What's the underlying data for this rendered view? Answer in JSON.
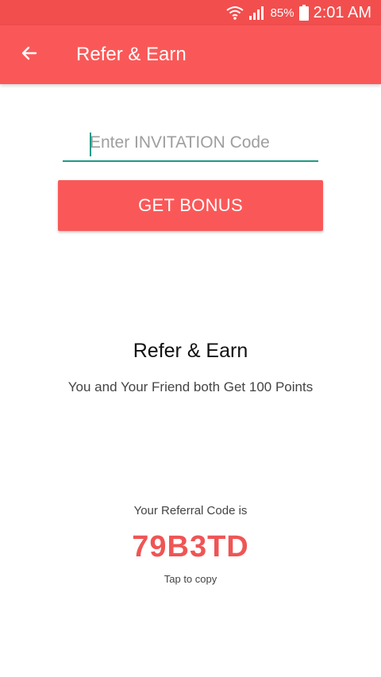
{
  "status_bar": {
    "battery_percent": "85%",
    "time": "2:01 AM",
    "icons": [
      "wifi-icon",
      "signal-icon",
      "battery-icon"
    ]
  },
  "app_bar": {
    "title": "Refer & Earn",
    "back_icon": "arrow-left-icon"
  },
  "invitation": {
    "placeholder": "Enter INVITATION Code",
    "value": "",
    "button_label": "GET BONUS"
  },
  "refer_section": {
    "title": "Refer & Earn",
    "subtitle": "You and Your Friend both Get 100 Points"
  },
  "referral": {
    "label": "Your Referral Code is",
    "code": "79B3TD",
    "hint": "Tap to copy"
  },
  "colors": {
    "primary": "#fa5858",
    "status_bar": "#f24e4e",
    "accent": "#1e9a87",
    "code_text": "#ef5555"
  }
}
